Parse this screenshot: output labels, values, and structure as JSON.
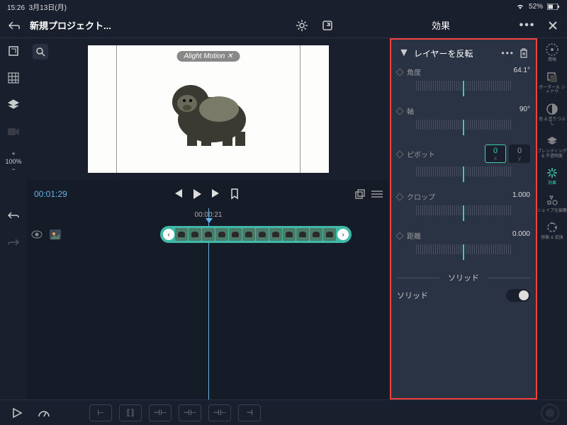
{
  "status": {
    "time": "15:26",
    "date": "3月13日(月)",
    "battery": "52%"
  },
  "header": {
    "project_title": "新規プロジェクト...",
    "panel_title": "効果"
  },
  "preview": {
    "watermark": "Alight Motion ✕"
  },
  "transport": {
    "timecode": "00:01:29",
    "ruler_time": "00:00:21"
  },
  "zoom": {
    "plus": "+",
    "value": "100%",
    "minus": "−"
  },
  "effect": {
    "title": "レイヤーを反転",
    "params": {
      "angle": {
        "label": "角度",
        "value": "64.1°"
      },
      "axis": {
        "label": "軸",
        "value": "90°"
      },
      "pivot": {
        "label": "ピボット",
        "x": "0",
        "x_label": "x",
        "y": "0",
        "y_label": "y"
      },
      "crop": {
        "label": "クロップ",
        "value": "1.000"
      },
      "distance": {
        "label": "距離",
        "value": "0.000"
      }
    },
    "section": "ソリッド",
    "solid_label": "ソリッド"
  },
  "right_tools": {
    "info": "情報",
    "border": "ボーダー＆\nシャドウ",
    "fill": "色 & 塗りつぶし",
    "blend": "ブレンディング\n& 不透明度",
    "effects": "効果",
    "shape": "シェイプを編集",
    "transform": "移動 & 変換"
  }
}
